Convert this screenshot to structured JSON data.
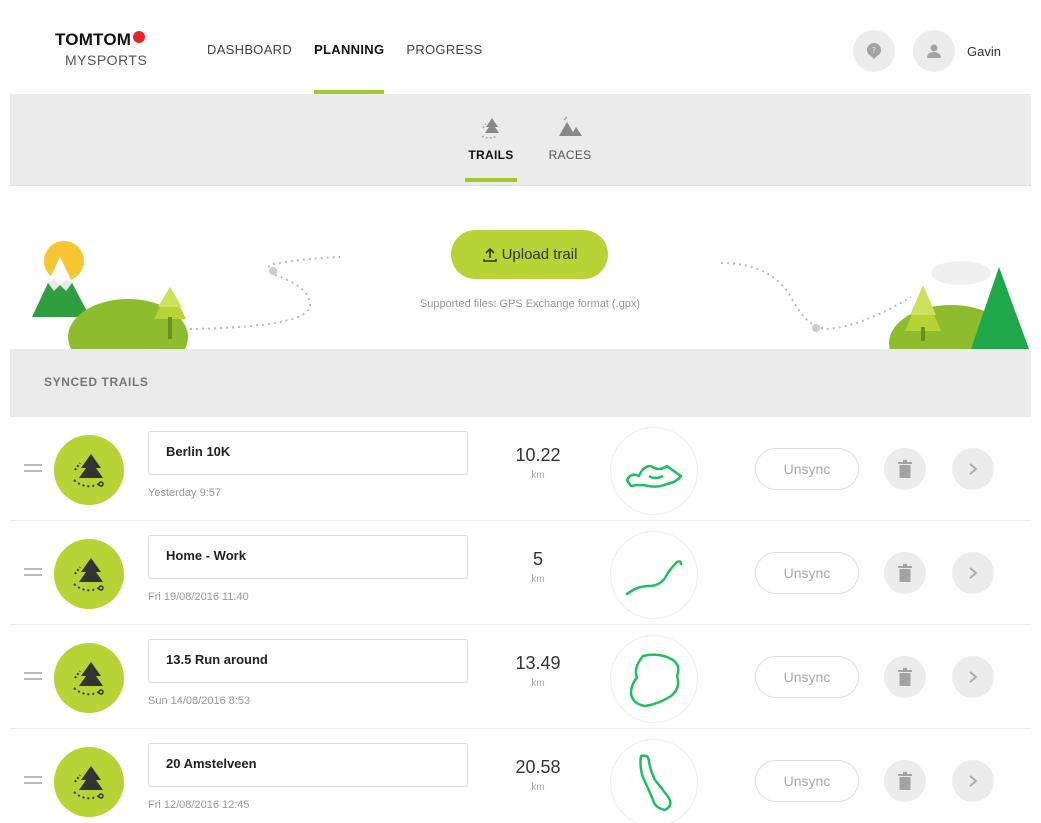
{
  "header": {
    "logo_top": "TOMTOM",
    "logo_bottom": "MYSPORTS",
    "nav": [
      {
        "label": "DASHBOARD",
        "active": false
      },
      {
        "label": "PLANNING",
        "active": true
      },
      {
        "label": "PROGRESS",
        "active": false
      }
    ],
    "user_name": "Gavin"
  },
  "subnav": {
    "tabs": [
      {
        "label": "TRAILS",
        "active": true
      },
      {
        "label": "RACES",
        "active": false
      }
    ]
  },
  "upload": {
    "button_label": "Upload trail",
    "supported_text": "Supported files: GPS Exchange format (.gpx)"
  },
  "synced_title": "SYNCED TRAILS",
  "unsync_label": "Unsync",
  "trails": [
    {
      "name": "Berlin 10K",
      "date": "Yesterday 9:57",
      "distance": "10.22",
      "unit": "km"
    },
    {
      "name": "Home - Work",
      "date": "Fri 19/08/2016 11:40",
      "distance": "5",
      "unit": "km"
    },
    {
      "name": "13.5 Run around",
      "date": "Sun 14/08/2016 8:53",
      "distance": "13.49",
      "unit": "km"
    },
    {
      "name": "20 Amstelveen",
      "date": "Fri 12/08/2016 12:45",
      "distance": "20.58",
      "unit": "km"
    }
  ],
  "colors": {
    "accent": "#a5c828",
    "button_green": "#b7d335",
    "route_green": "#1fbf61",
    "brand_red": "#e5242b"
  }
}
